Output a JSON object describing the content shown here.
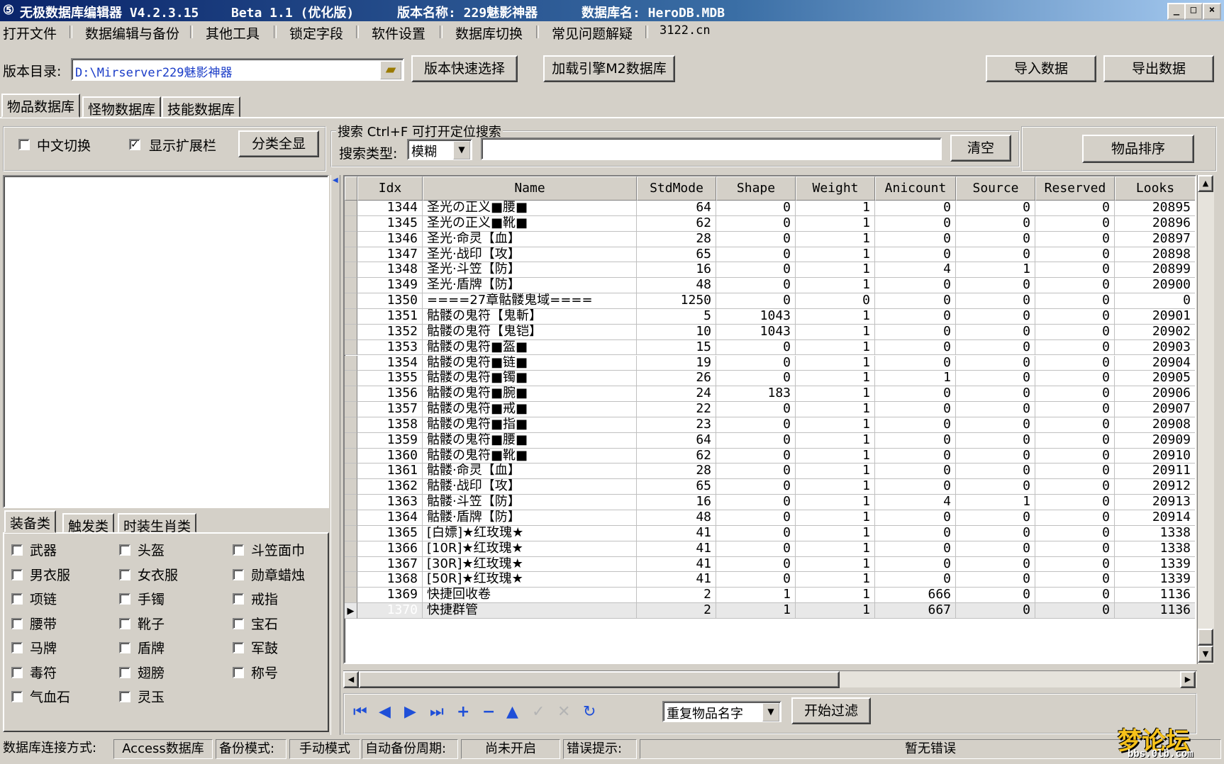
{
  "window": {
    "title": "无极数据库编辑器 V4.2.3.15",
    "beta": "Beta 1.1 (优化版)",
    "version_name": "版本名称: 229魅影神器",
    "db_name": "数据库名: HeroDB.MDB"
  },
  "menu": [
    "打开文件",
    "数据编辑与备份",
    "其他工具",
    "锁定字段",
    "软件设置",
    "数据库切换",
    "常见问题解疑",
    "3122.cn"
  ],
  "toolbar": {
    "dir_label": "版本目录:",
    "dir_value": "D:\\Mirserver229魅影神器",
    "quick_select": "版本快速选择",
    "load_engine": "加载引擎M2数据库",
    "import": "导入数据",
    "export": "导出数据"
  },
  "db_tabs": [
    "物品数据库",
    "怪物数据库",
    "技能数据库"
  ],
  "left_panel": {
    "chinese_toggle": "中文切换",
    "chinese_toggle_checked": false,
    "show_ext": "显示扩展栏",
    "show_ext_checked": true,
    "show_all": "分类全显",
    "category_tabs": [
      "装备类",
      "触发类",
      "时装生肖类"
    ],
    "categories": [
      "武器",
      "头盔",
      "斗笠面巾",
      "男衣服",
      "女衣服",
      "勋章蜡烛",
      "项链",
      "手镯",
      "戒指",
      "腰带",
      "靴子",
      "宝石",
      "马牌",
      "盾牌",
      "军鼓",
      "毒符",
      "翅膀",
      "称号",
      "气血石",
      "灵玉"
    ]
  },
  "search": {
    "group_label": "搜索  Ctrl+F 可打开定位搜索",
    "type_label": "搜索类型:",
    "type_value": "模糊",
    "query": "",
    "clear": "清空",
    "sort": "物品排序"
  },
  "grid": {
    "columns": [
      "Idx",
      "Name",
      "StdMode",
      "Shape",
      "Weight",
      "Anicount",
      "Source",
      "Reserved",
      "Looks"
    ],
    "rows": [
      [
        "1344",
        "圣光の正义■腰■",
        "64",
        "0",
        "1",
        "0",
        "0",
        "0",
        "20895"
      ],
      [
        "1345",
        "圣光の正义■靴■",
        "62",
        "0",
        "1",
        "0",
        "0",
        "0",
        "20896"
      ],
      [
        "1346",
        "圣光·命灵【血】",
        "28",
        "0",
        "1",
        "0",
        "0",
        "0",
        "20897"
      ],
      [
        "1347",
        "圣光·战印【攻】",
        "65",
        "0",
        "1",
        "0",
        "0",
        "0",
        "20898"
      ],
      [
        "1348",
        "圣光·斗笠【防】",
        "16",
        "0",
        "1",
        "4",
        "1",
        "0",
        "20899"
      ],
      [
        "1349",
        "圣光·盾牌【防】",
        "48",
        "0",
        "1",
        "0",
        "0",
        "0",
        "20900"
      ],
      [
        "1350",
        "====27章骷髅鬼域====",
        "1250",
        "0",
        "0",
        "0",
        "0",
        "0",
        "0"
      ],
      [
        "1351",
        "骷髅の鬼符【鬼斬】",
        "5",
        "1043",
        "1",
        "0",
        "0",
        "0",
        "20901"
      ],
      [
        "1352",
        "骷髅の鬼符【鬼铠】",
        "10",
        "1043",
        "1",
        "0",
        "0",
        "0",
        "20902"
      ],
      [
        "1353",
        "骷髅の鬼符■盔■",
        "15",
        "0",
        "1",
        "0",
        "0",
        "0",
        "20903"
      ],
      [
        "1354",
        "骷髅の鬼符■链■",
        "19",
        "0",
        "1",
        "0",
        "0",
        "0",
        "20904"
      ],
      [
        "1355",
        "骷髅の鬼符■镯■",
        "26",
        "0",
        "1",
        "1",
        "0",
        "0",
        "20905"
      ],
      [
        "1356",
        "骷髅の鬼符■腕■",
        "24",
        "183",
        "1",
        "0",
        "0",
        "0",
        "20906"
      ],
      [
        "1357",
        "骷髅の鬼符■戒■",
        "22",
        "0",
        "1",
        "0",
        "0",
        "0",
        "20907"
      ],
      [
        "1358",
        "骷髅の鬼符■指■",
        "23",
        "0",
        "1",
        "0",
        "0",
        "0",
        "20908"
      ],
      [
        "1359",
        "骷髅の鬼符■腰■",
        "64",
        "0",
        "1",
        "0",
        "0",
        "0",
        "20909"
      ],
      [
        "1360",
        "骷髅の鬼符■靴■",
        "62",
        "0",
        "1",
        "0",
        "0",
        "0",
        "20910"
      ],
      [
        "1361",
        "骷髅·命灵【血】",
        "28",
        "0",
        "1",
        "0",
        "0",
        "0",
        "20911"
      ],
      [
        "1362",
        "骷髅·战印【攻】",
        "65",
        "0",
        "1",
        "0",
        "0",
        "0",
        "20912"
      ],
      [
        "1363",
        "骷髅·斗笠【防】",
        "16",
        "0",
        "1",
        "4",
        "1",
        "0",
        "20913"
      ],
      [
        "1364",
        "骷髅·盾牌【防】",
        "48",
        "0",
        "1",
        "0",
        "0",
        "0",
        "20914"
      ],
      [
        "1365",
        "[白嫖]★红玫瑰★",
        "41",
        "0",
        "1",
        "0",
        "0",
        "0",
        "1338"
      ],
      [
        "1366",
        "[10R]★红玫瑰★",
        "41",
        "0",
        "1",
        "0",
        "0",
        "0",
        "1338"
      ],
      [
        "1367",
        "[30R]★红玫瑰★",
        "41",
        "0",
        "1",
        "0",
        "0",
        "0",
        "1339"
      ],
      [
        "1368",
        "[50R]★红玫瑰★",
        "41",
        "0",
        "1",
        "0",
        "0",
        "0",
        "1339"
      ],
      [
        "1369",
        "快捷回收卷",
        "2",
        "1",
        "1",
        "666",
        "0",
        "0",
        "1136"
      ],
      [
        "1370",
        "快捷群管",
        "2",
        "1",
        "1",
        "667",
        "0",
        "0",
        "1136"
      ]
    ],
    "selected_index": 26
  },
  "navigator": {
    "icons": [
      "first-icon",
      "prior-icon",
      "next-icon",
      "last-icon",
      "insert-icon",
      "delete-icon",
      "edit-icon",
      "post-icon",
      "cancel-icon",
      "refresh-icon"
    ],
    "filter_value": "重复物品名字",
    "filter_button": "开始过滤"
  },
  "status": {
    "conn_label": "数据库连接方式:",
    "conn_value": "Access数据库",
    "backup_label": "备份模式:",
    "backup_value": "手动模式",
    "auto_label": "自动备份周期:",
    "auto_value": "尚未开启",
    "error_label": "错误提示:",
    "error_value": "暂无错误"
  },
  "watermark": "bbs.0lb.com"
}
